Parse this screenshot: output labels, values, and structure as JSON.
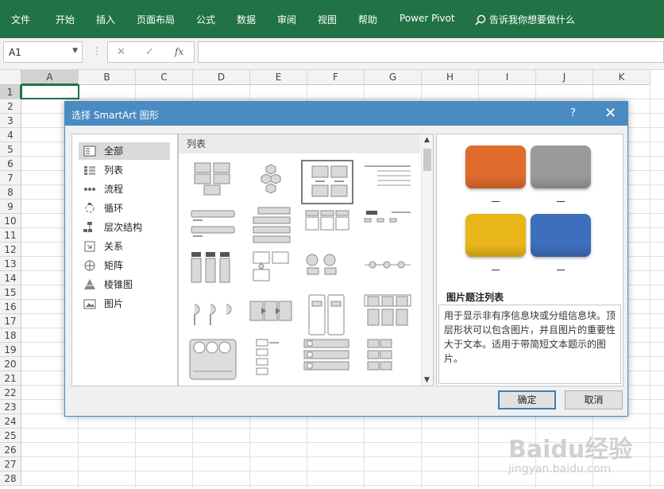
{
  "ribbon": {
    "tabs": [
      "文件",
      "开始",
      "插入",
      "页面布局",
      "公式",
      "数据",
      "审阅",
      "视图",
      "帮助",
      "Power Pivot"
    ],
    "tell_me": "告诉我你想要做什么"
  },
  "formula_bar": {
    "name_box": "A1",
    "fx": "fx",
    "value": ""
  },
  "sheet": {
    "columns": [
      "A",
      "B",
      "C",
      "D",
      "E",
      "F",
      "G",
      "H",
      "I",
      "J",
      "K"
    ],
    "rows": [
      "1",
      "2",
      "3",
      "4",
      "5",
      "6",
      "7",
      "8",
      "9",
      "10",
      "11",
      "12",
      "13",
      "14",
      "15",
      "16",
      "17",
      "18",
      "19",
      "20",
      "21",
      "22",
      "23",
      "24",
      "25",
      "26",
      "27",
      "28"
    ],
    "selected_cell": "A1"
  },
  "dialog": {
    "title": "选择 SmartArt 图形",
    "help": "?",
    "close": "✕",
    "categories": [
      {
        "label": "全部",
        "icon": "all-icon"
      },
      {
        "label": "列表",
        "icon": "list-icon"
      },
      {
        "label": "流程",
        "icon": "process-icon"
      },
      {
        "label": "循环",
        "icon": "cycle-icon"
      },
      {
        "label": "层次结构",
        "icon": "hierarchy-icon"
      },
      {
        "label": "关系",
        "icon": "relationship-icon"
      },
      {
        "label": "矩阵",
        "icon": "matrix-icon"
      },
      {
        "label": "棱锥图",
        "icon": "pyramid-icon"
      },
      {
        "label": "图片",
        "icon": "picture-icon"
      }
    ],
    "active_category": "全部",
    "gallery_header": "列表",
    "preview": {
      "name": "图片题注列表",
      "description": "用于显示非有序信息块或分组信息块。顶层形状可以包含图片，并且图片的重要性大于文本。适用于带简短文本题示的图片。",
      "colors": [
        "#e06b2c",
        "#9a9a9a",
        "#e8b619",
        "#3e6fbd"
      ]
    },
    "ok": "确定",
    "cancel": "取消"
  },
  "watermark": {
    "brand": "Baidu经验",
    "url": "jingyan.baidu.com"
  }
}
